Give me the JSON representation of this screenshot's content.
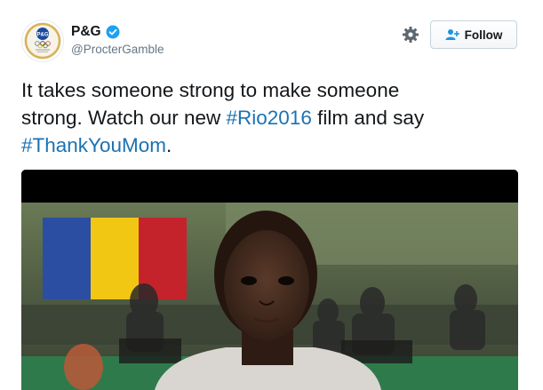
{
  "account": {
    "display_name": "P&G",
    "handle": "@ProcterGamble",
    "verified": true,
    "avatar_icon": "pg-olympic-logo",
    "logo_text": "P&G"
  },
  "actions": {
    "settings_icon": "gear-icon",
    "follow_label": "Follow",
    "follow_icon": "add-user-icon"
  },
  "tweet": {
    "line1": "It takes someone strong to make someone",
    "line2_start": "strong. Watch our new ",
    "hashtag_rio": "#Rio2016",
    "line2_end": " film and say",
    "hashtag_mom": "#ThankYouMom",
    "end_punct": "."
  },
  "colors": {
    "hashtag": "#1b72b3",
    "verified_badge": "#1da1f2",
    "text": "#14171a",
    "secondary_text": "#657786"
  },
  "media": {
    "type": "video-still",
    "flag_colors": [
      "#2b4ea2",
      "#f2c714",
      "#c4232c"
    ]
  }
}
